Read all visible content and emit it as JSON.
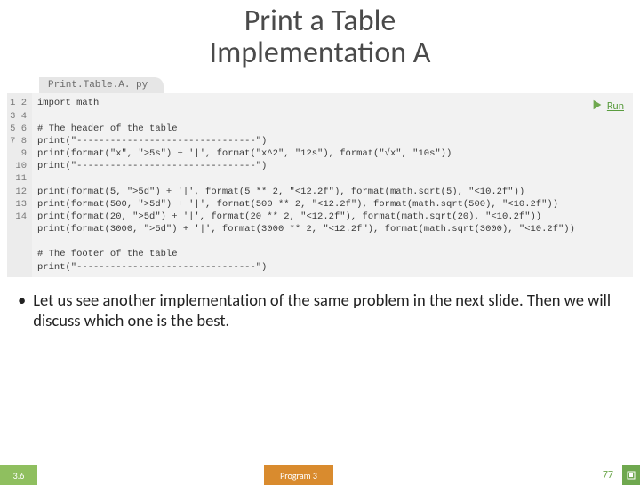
{
  "title_line1": "Print a Table",
  "title_line2": "Implementation A",
  "tab_label": "Print.Table.A. py",
  "run_label": "Run",
  "gutter": [
    "1",
    "2",
    "3",
    "4",
    "5",
    "6",
    "7",
    "8",
    "9",
    "10",
    "11",
    "12",
    "13",
    "14"
  ],
  "code_lines": [
    "import math",
    "",
    "# The header of the table",
    "print(\"--------------------------------\")",
    "print(format(\"x\", \">5s\") + '|', format(\"x^2\", \"12s\"), format(\"√x\", \"10s\"))",
    "print(\"--------------------------------\")",
    "",
    "print(format(5, \">5d\") + '|', format(5 ** 2, \"<12.2f\"), format(math.sqrt(5), \"<10.2f\"))",
    "print(format(500, \">5d\") + '|', format(500 ** 2, \"<12.2f\"), format(math.sqrt(500), \"<10.2f\"))",
    "print(format(20, \">5d\") + '|', format(20 ** 2, \"<12.2f\"), format(math.sqrt(20), \"<10.2f\"))",
    "print(format(3000, \">5d\") + '|', format(3000 ** 2, \"<12.2f\"), format(math.sqrt(3000), \"<10.2f\"))",
    "",
    "# The footer of the table",
    "print(\"--------------------------------\")"
  ],
  "bullet_text": "Let us see another implementation of the same problem in the next slide. Then we will discuss which one is the best.",
  "footer": {
    "section": "3.6",
    "program": "Program 3",
    "page": "77"
  }
}
